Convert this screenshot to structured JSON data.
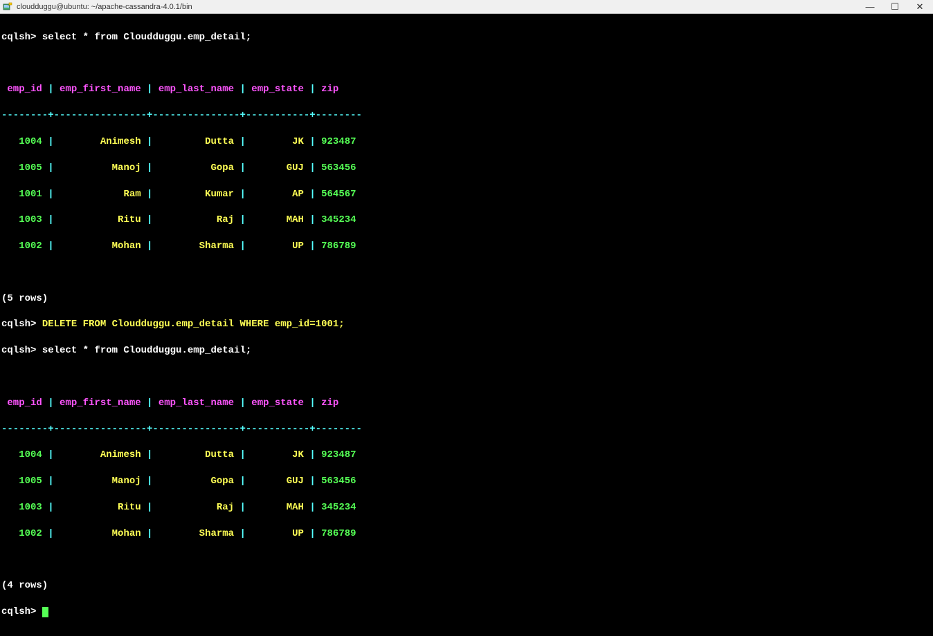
{
  "window": {
    "title": "cloudduggu@ubuntu: ~/apache-cassandra-4.0.1/bin",
    "icon_name": "putty-icon",
    "buttons": {
      "min": "—",
      "max": "☐",
      "close": "✕"
    }
  },
  "prompt": "cqlsh> ",
  "queries": {
    "select1": "select * from Cloudduggu.emp_detail;",
    "delete": "DELETE FROM Cloudduggu.emp_detail WHERE emp_id=1001;",
    "select2": "select * from Cloudduggu.emp_detail;"
  },
  "headers": {
    "c0": " emp_id ",
    "c1": " emp_first_name ",
    "c2": " emp_last_name ",
    "c3": " emp_state ",
    "c4": " zip"
  },
  "sep_pipe": "|",
  "divider": "--------+----------------+---------------+-----------+--------",
  "divider_plus": "+",
  "table1": {
    "rows": [
      {
        "id": "   1004 ",
        "fn": "        Animesh ",
        "ln": "         Dutta ",
        "st": "        JK ",
        "zip": " 923487"
      },
      {
        "id": "   1005 ",
        "fn": "          Manoj ",
        "ln": "          Gopa ",
        "st": "       GUJ ",
        "zip": " 563456"
      },
      {
        "id": "   1001 ",
        "fn": "            Ram ",
        "ln": "         Kumar ",
        "st": "        AP ",
        "zip": " 564567"
      },
      {
        "id": "   1003 ",
        "fn": "           Ritu ",
        "ln": "           Raj ",
        "st": "       MAH ",
        "zip": " 345234"
      },
      {
        "id": "   1002 ",
        "fn": "          Mohan ",
        "ln": "        Sharma ",
        "st": "        UP ",
        "zip": " 786789"
      }
    ],
    "summary": "(5 rows)"
  },
  "table2": {
    "rows": [
      {
        "id": "   1004 ",
        "fn": "        Animesh ",
        "ln": "         Dutta ",
        "st": "        JK ",
        "zip": " 923487"
      },
      {
        "id": "   1005 ",
        "fn": "          Manoj ",
        "ln": "          Gopa ",
        "st": "       GUJ ",
        "zip": " 563456"
      },
      {
        "id": "   1003 ",
        "fn": "           Ritu ",
        "ln": "           Raj ",
        "st": "       MAH ",
        "zip": " 345234"
      },
      {
        "id": "   1002 ",
        "fn": "          Mohan ",
        "ln": "        Sharma ",
        "st": "        UP ",
        "zip": " 786789"
      }
    ],
    "summary": "(4 rows)"
  }
}
